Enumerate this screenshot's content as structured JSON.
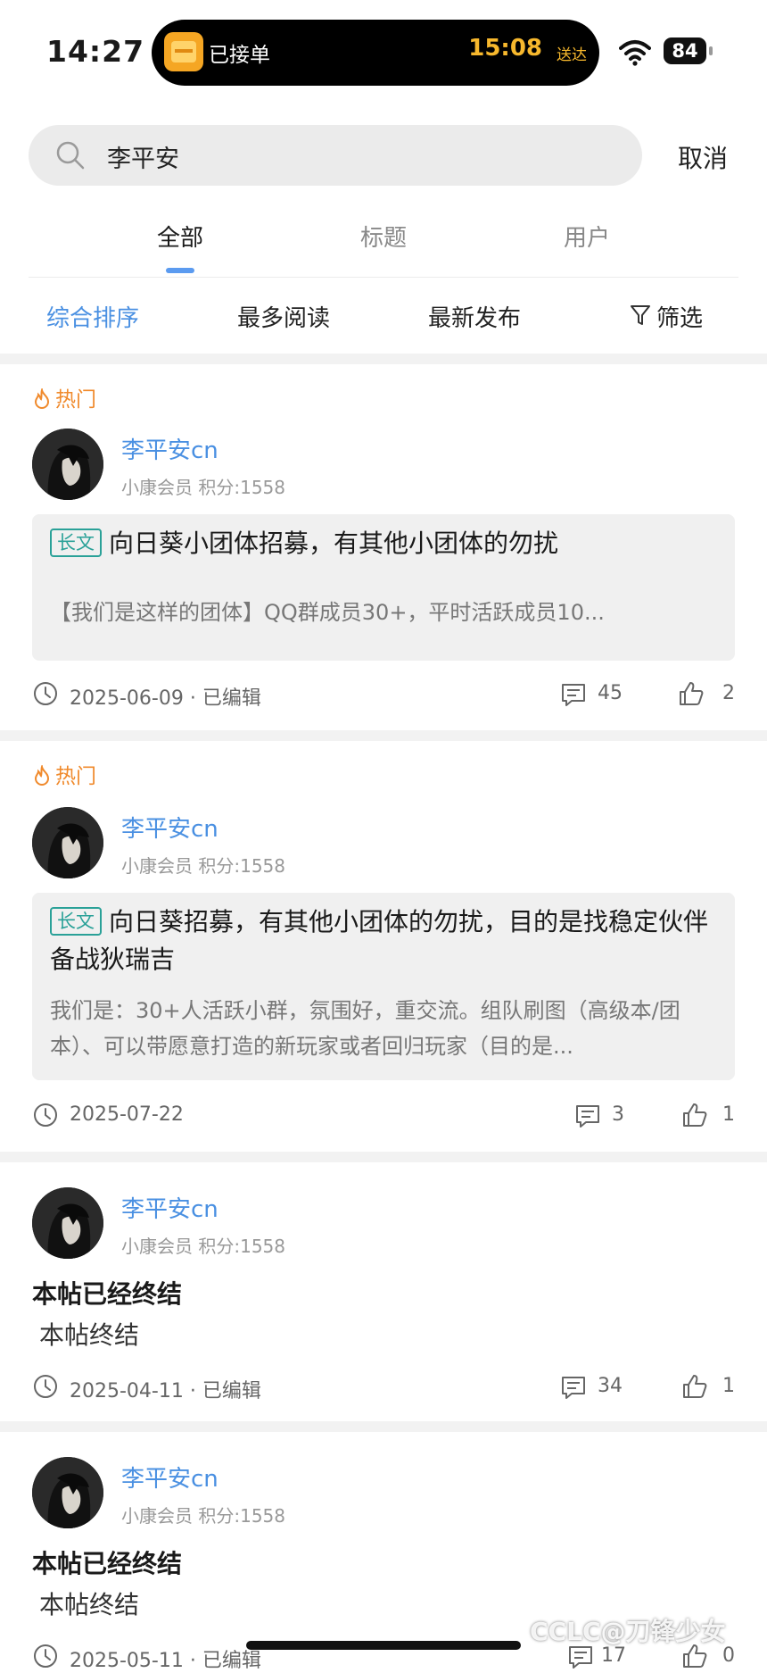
{
  "status_bar": {
    "time": "14:27",
    "island_label": "已接单",
    "island_eta": "15:08",
    "island_eta_suffix": "送达",
    "battery": "84"
  },
  "search": {
    "query": "李平安",
    "cancel": "取消"
  },
  "tabs": [
    {
      "label": "全部",
      "active": true
    },
    {
      "label": "标题",
      "active": false
    },
    {
      "label": "用户",
      "active": false
    }
  ],
  "sort": [
    {
      "label": "综合排序",
      "active": true
    },
    {
      "label": "最多阅读",
      "active": false
    },
    {
      "label": "最新发布",
      "active": false
    },
    {
      "label": "筛选",
      "active": false
    }
  ],
  "posts": [
    {
      "hot": "热门",
      "author": "李平安cn",
      "member": "小康会员  积分:1558",
      "badge": "长文",
      "title": "向日葵小团体招募，有其他小团体的勿扰",
      "excerpt": "【我们是这样的团体】QQ群成员30+，平时活跃成员10...",
      "date": "2025-06-09 · 已编辑",
      "comments": "45",
      "likes": "2"
    },
    {
      "hot": "热门",
      "author": "李平安cn",
      "member": "小康会员  积分:1558",
      "badge": "长文",
      "title": "向日葵招募，有其他小团体的勿扰，目的是找稳定伙伴备战狄瑞吉",
      "excerpt": "我们是：30+人活跃小群，氛围好，重交流。组队刷图（高级本/团本）、可以带愿意打造的新玩家或者回归玩家（目的是...",
      "date": "2025-07-22",
      "comments": "3",
      "likes": "1"
    },
    {
      "author": "李平安cn",
      "member": "小康会员  积分:1558",
      "title": "本帖已经终结",
      "body": "本帖终结",
      "date": "2025-04-11 · 已编辑",
      "comments": "34",
      "likes": "1"
    },
    {
      "author": "李平安cn",
      "member": "小康会员  积分:1558",
      "title": "本帖已经终结",
      "body": "本帖终结",
      "date": "2025-05-11 · 已编辑",
      "comments": "17",
      "likes": "0"
    }
  ],
  "watermark": "CCLC@刀锋少女",
  "colors": {
    "accent": "#4a90e2",
    "hot": "#f08a2c",
    "badge": "#2aa198",
    "island_eta": "#f7b82d"
  }
}
